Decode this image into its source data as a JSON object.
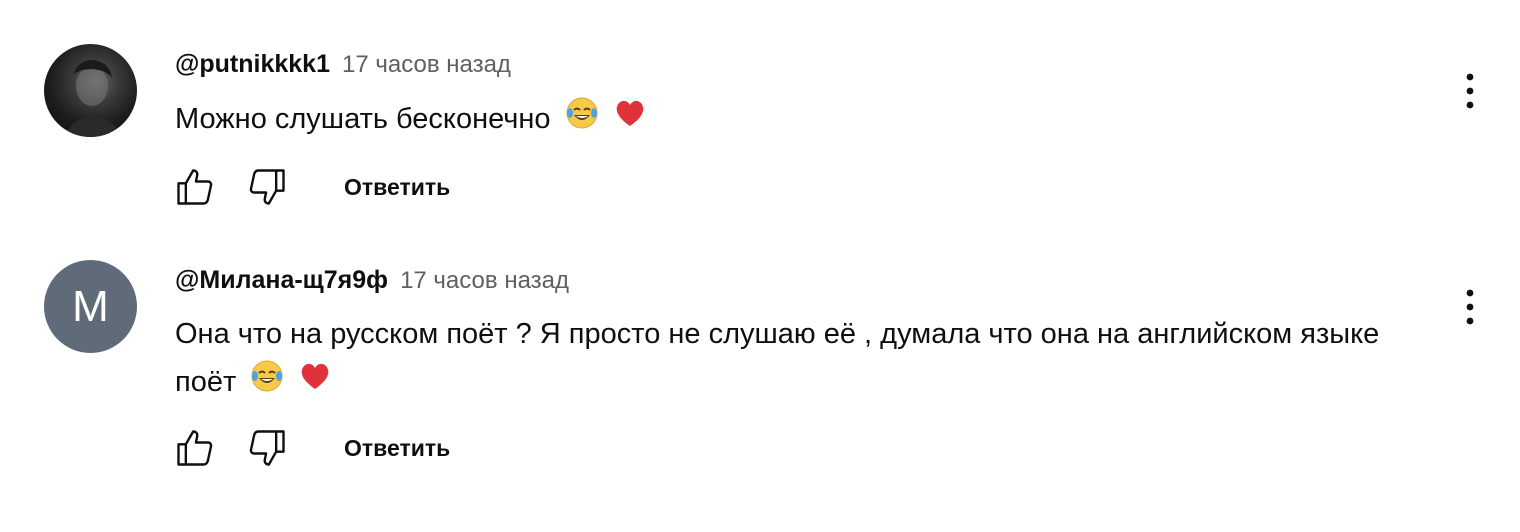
{
  "comments": [
    {
      "author": "@putnikkkk1",
      "time": "17 часов назад",
      "text": "Можно слушать бесконечно",
      "avatar_type": "photo",
      "emojis": [
        "face-with-tears-of-joy-icon",
        "red-heart-icon"
      ],
      "reply_label": "Ответить"
    },
    {
      "author": "@Милана-щ7я9ф",
      "time": "17 часов назад",
      "text": "Она что на русском поёт ? Я просто не слушаю её , думала что она на английском языке поёт",
      "avatar_letter": "M",
      "avatar_color": "#5f6b78",
      "emojis": [
        "face-with-tears-of-joy-icon",
        "red-heart-icon"
      ],
      "reply_label": "Ответить"
    }
  ],
  "colors": {
    "text": "#0f0f0f",
    "secondary_text": "#606060",
    "avatar_letter_bg": "#5f6b78",
    "heart": "#e0323b"
  },
  "icons": [
    "like-icon",
    "dislike-icon",
    "more-vert-icon"
  ]
}
